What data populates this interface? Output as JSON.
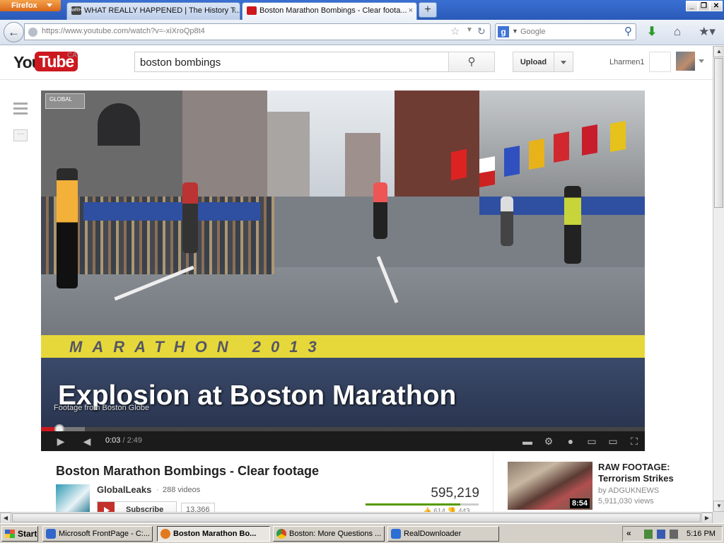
{
  "browser": {
    "menu_button": "Firefox",
    "tabs": [
      {
        "label": "WHAT REALLY HAPPENED | The History T...",
        "close": "×",
        "favicon": "wrh-icon",
        "active": false
      },
      {
        "label": "Boston Marathon Bombings - Clear foota...",
        "close": "×",
        "favicon": "youtube-icon",
        "active": true
      }
    ],
    "new_tab": "+",
    "window_controls": {
      "minimize": "_",
      "restore": "❐",
      "close": "✕"
    },
    "url": "https://www.youtube.com/watch?v=-xiXroQp8t4",
    "search_engine_placeholder": "Google",
    "icons": {
      "back": "back-arrow-icon",
      "bookmark": "star-icon",
      "reload": "reload-icon",
      "download": "download-arrow-icon",
      "home": "home-icon",
      "bookmarks_menu": "bookmarks-menu-icon"
    }
  },
  "youtube": {
    "logo_you": "You",
    "logo_tube": "Tube",
    "region": "CA",
    "search_query": "boston bombings",
    "upload_label": "Upload",
    "username": "Lharmen1"
  },
  "player": {
    "badge": "GLOBAL",
    "finish_line_text": "MARATHON  2013",
    "caption_title": "Explosion at Boston Marathon",
    "caption_sub": "Footage from Boston Globe",
    "current_time": "0:03",
    "duration": "/ 2:49",
    "played_fraction": 0.03,
    "buffered_fraction": 0.073,
    "accent_color": "#cc181e"
  },
  "video": {
    "title": "Boston Marathon Bombings - Clear footage",
    "channel": "GlobalLeaks",
    "separator": "·",
    "channel_videos": "288 videos",
    "subscribe_label": "Subscribe",
    "subscriber_count": "13,366",
    "views": "595,219",
    "likes": "614",
    "dislikes": "443",
    "like_ratio": 0.84
  },
  "related": [
    {
      "title": "RAW FOOTAGE: Terrorism Strikes",
      "by": "by ADGUKNEWS",
      "views": "5,911,030 views",
      "duration": "8:54"
    }
  ],
  "taskbar": {
    "start": "Start",
    "tasks": [
      {
        "label": "Microsoft FrontPage - C:...",
        "active": false,
        "color": "#3366cc"
      },
      {
        "label": "Boston Marathon Bo...",
        "active": true,
        "color": "#e2791e"
      },
      {
        "label": "Boston: More Questions ...",
        "active": false,
        "color": "#dd4422"
      },
      {
        "label": "RealDownloader",
        "active": false,
        "color": "#2b6fd6"
      }
    ],
    "tray_chevron": "«",
    "clock": "5:16 PM"
  }
}
